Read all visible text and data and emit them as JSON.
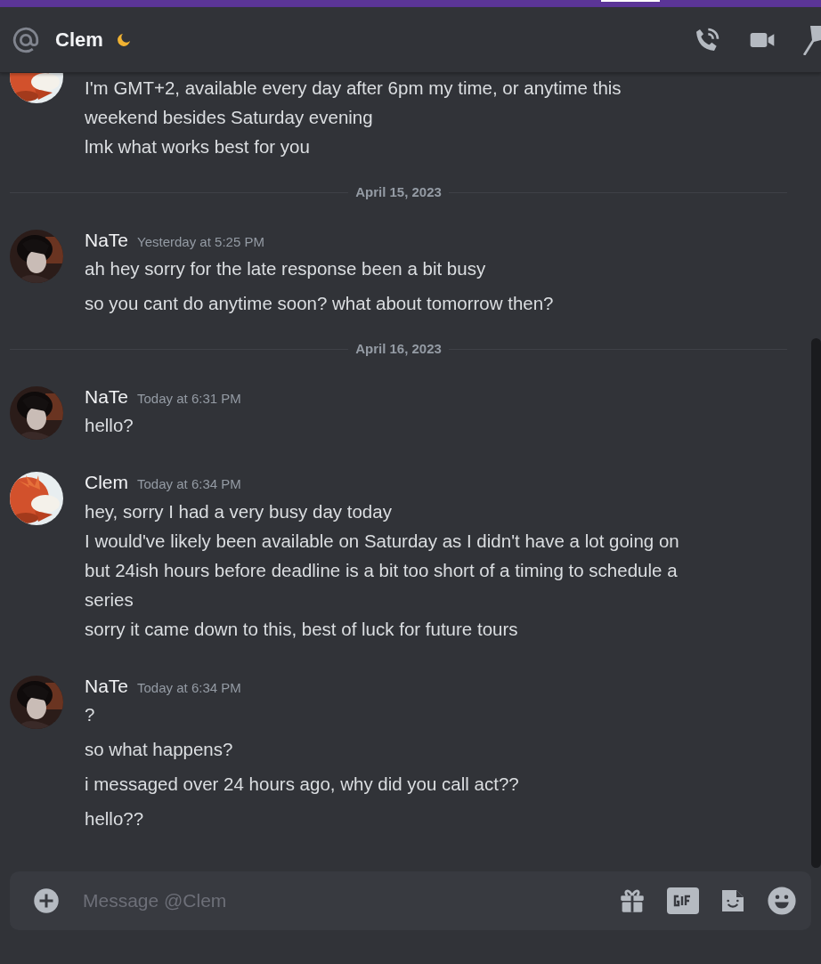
{
  "header": {
    "channel_name": "Clem"
  },
  "messages": [
    {
      "kind": "continuation",
      "messages": [
        "I'm GMT+2, available every day after 6pm my time, or anytime this weekend besides Saturday evening\nlmk what works best for you"
      ]
    },
    {
      "kind": "divider",
      "date": "April 15, 2023"
    },
    {
      "kind": "group",
      "author": "NaTe",
      "timestamp": "Yesterday at 5:25 PM",
      "messages": [
        "ah hey sorry for the late response been a bit busy",
        "so you cant do anytime soon? what about tomorrow then?"
      ]
    },
    {
      "kind": "divider",
      "date": "April 16, 2023"
    },
    {
      "kind": "group",
      "author": "NaTe",
      "timestamp": "Today at 6:31 PM",
      "messages": [
        "hello?"
      ]
    },
    {
      "kind": "group",
      "author": "Clem",
      "timestamp": "Today at 6:34 PM",
      "messages": [
        "hey, sorry I had a very busy day today\nI would've likely been available on Saturday as I didn't have a lot going on\nbut 24ish hours before deadline is a bit too short of a timing to schedule a series\nsorry it came down to this, best of luck for future tours"
      ]
    },
    {
      "kind": "group",
      "author": "NaTe",
      "timestamp": "Today at 6:34 PM",
      "messages": [
        "?",
        "so what happens?",
        "i messaged over 24 hours ago, why did you call act??",
        "hello??"
      ]
    }
  ],
  "composer": {
    "placeholder": "Message @Clem"
  }
}
